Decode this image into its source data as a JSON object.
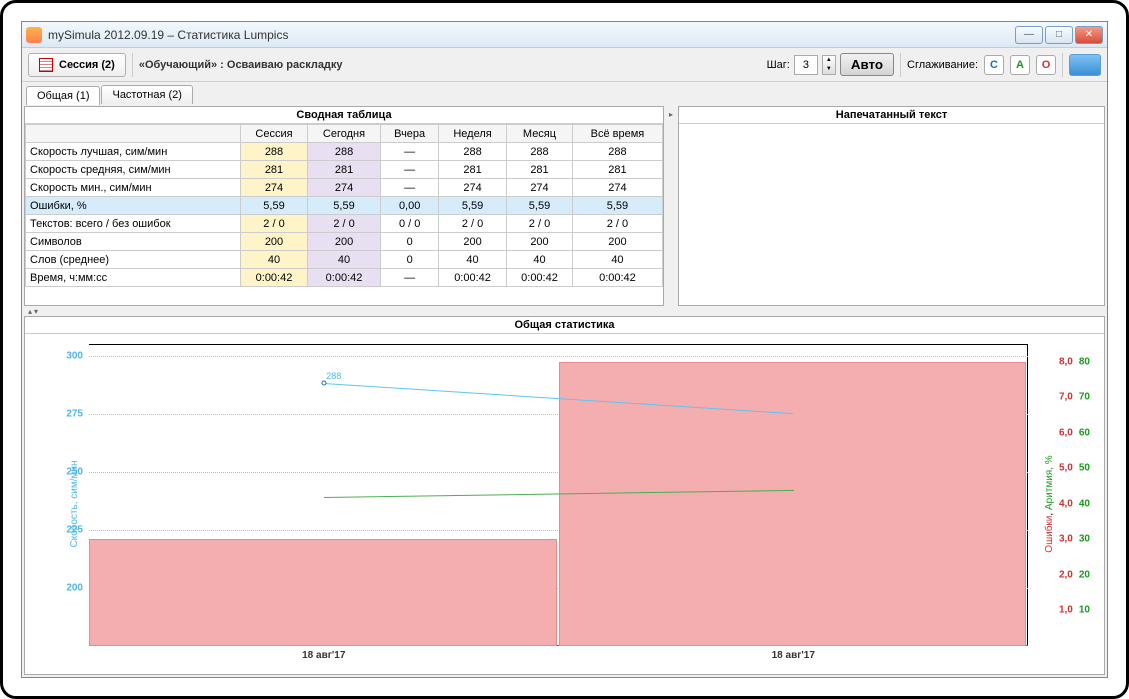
{
  "window": {
    "title": "mySimula 2012.09.19 – Статистика Lumpics"
  },
  "toolbar": {
    "session_label": "Сессия (2)",
    "mode_label": "«Обучающий» : Осваиваю раскладку",
    "step_label": "Шаг:",
    "step_value": "3",
    "auto_label": "Авто",
    "smoothing_label": "Сглаживание:",
    "btn_c": "С",
    "btn_a": "А",
    "btn_o": "О"
  },
  "tabs": {
    "general": "Общая (1)",
    "frequency": "Частотная (2)"
  },
  "summary": {
    "title": "Сводная таблица",
    "cols": [
      "Сессия",
      "Сегодня",
      "Вчера",
      "Неделя",
      "Месяц",
      "Всё время"
    ],
    "rows": [
      {
        "label": "Скорость лучшая, сим/мин",
        "vals": [
          "288",
          "288",
          "—",
          "288",
          "288",
          "288"
        ]
      },
      {
        "label": "Скорость средняя, сим/мин",
        "vals": [
          "281",
          "281",
          "—",
          "281",
          "281",
          "281"
        ]
      },
      {
        "label": "Скорость мин., сим/мин",
        "vals": [
          "274",
          "274",
          "—",
          "274",
          "274",
          "274"
        ]
      },
      {
        "label": "Ошибки, %",
        "vals": [
          "5,59",
          "5,59",
          "0,00",
          "5,59",
          "5,59",
          "5,59"
        ],
        "hl": true
      },
      {
        "label": "Текстов: всего / без ошибок",
        "vals": [
          "2 / 0",
          "2 / 0",
          "0 / 0",
          "2 / 0",
          "2 / 0",
          "2 / 0"
        ]
      },
      {
        "label": "Символов",
        "vals": [
          "200",
          "200",
          "0",
          "200",
          "200",
          "200"
        ]
      },
      {
        "label": "Слов (среднее)",
        "vals": [
          "40",
          "40",
          "0",
          "40",
          "40",
          "40"
        ]
      },
      {
        "label": "Время, ч:мм:сс",
        "vals": [
          "0:00:42",
          "0:00:42",
          "—",
          "0:00:42",
          "0:00:42",
          "0:00:42"
        ]
      }
    ]
  },
  "typed_panel": {
    "title": "Напечатанный текст"
  },
  "chart": {
    "title": "Общая статистика",
    "y_left_label": "Скорость, сим/мин",
    "y_right_label_err": "Ошибки",
    "y_right_label_ar": "Аритмия, %",
    "point_label": "288",
    "x1": "18 авг'17",
    "x2": "18 авг'17",
    "yl": {
      "300": "300",
      "275": "275",
      "250": "250",
      "225": "225",
      "200": "200"
    },
    "yr": [
      {
        "e": "8,0",
        "a": "80"
      },
      {
        "e": "7,0",
        "a": "70"
      },
      {
        "e": "6,0",
        "a": "60"
      },
      {
        "e": "5,0",
        "a": "50"
      },
      {
        "e": "4,0",
        "a": "40"
      },
      {
        "e": "3,0",
        "a": "30"
      },
      {
        "e": "2,0",
        "a": "20"
      },
      {
        "e": "1,0",
        "a": "10"
      }
    ]
  },
  "chart_data": {
    "type": "line",
    "title": "Общая статистика",
    "x": [
      "18 авг'17",
      "18 авг'17"
    ],
    "series": [
      {
        "name": "Скорость, сим/мин",
        "axis": "left",
        "values": [
          288,
          275
        ],
        "color": "#5ec5f0"
      },
      {
        "name": "Ошибки, %",
        "axis": "right-err",
        "values": [
          3.0,
          8.0
        ],
        "color": "#f4aeb0",
        "style": "bar"
      },
      {
        "name": "Аритмия, %",
        "axis": "right-ar",
        "values": [
          42,
          44
        ],
        "color": "#4caf50"
      }
    ],
    "y_left": {
      "label": "Скорость, сим/мин",
      "range": [
        175,
        305
      ],
      "ticks": [
        200,
        225,
        250,
        275,
        300
      ]
    },
    "y_right_err": {
      "label": "Ошибки",
      "range": [
        0,
        8.5
      ],
      "ticks": [
        1,
        2,
        3,
        4,
        5,
        6,
        7,
        8
      ]
    },
    "y_right_ar": {
      "label": "Аритмия, %",
      "range": [
        0,
        85
      ],
      "ticks": [
        10,
        20,
        30,
        40,
        50,
        60,
        70,
        80
      ]
    }
  }
}
